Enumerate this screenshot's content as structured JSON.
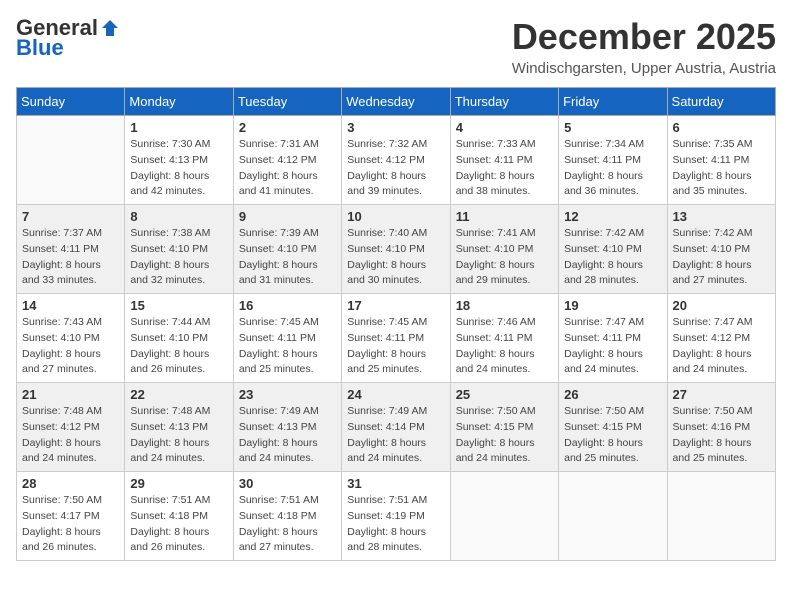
{
  "header": {
    "logo_general": "General",
    "logo_blue": "Blue",
    "month_title": "December 2025",
    "location": "Windischgarsten, Upper Austria, Austria"
  },
  "weekdays": [
    "Sunday",
    "Monday",
    "Tuesday",
    "Wednesday",
    "Thursday",
    "Friday",
    "Saturday"
  ],
  "weeks": [
    [
      {
        "day": "",
        "sunrise": "",
        "sunset": "",
        "daylight": ""
      },
      {
        "day": "1",
        "sunrise": "Sunrise: 7:30 AM",
        "sunset": "Sunset: 4:13 PM",
        "daylight": "Daylight: 8 hours and 42 minutes."
      },
      {
        "day": "2",
        "sunrise": "Sunrise: 7:31 AM",
        "sunset": "Sunset: 4:12 PM",
        "daylight": "Daylight: 8 hours and 41 minutes."
      },
      {
        "day": "3",
        "sunrise": "Sunrise: 7:32 AM",
        "sunset": "Sunset: 4:12 PM",
        "daylight": "Daylight: 8 hours and 39 minutes."
      },
      {
        "day": "4",
        "sunrise": "Sunrise: 7:33 AM",
        "sunset": "Sunset: 4:11 PM",
        "daylight": "Daylight: 8 hours and 38 minutes."
      },
      {
        "day": "5",
        "sunrise": "Sunrise: 7:34 AM",
        "sunset": "Sunset: 4:11 PM",
        "daylight": "Daylight: 8 hours and 36 minutes."
      },
      {
        "day": "6",
        "sunrise": "Sunrise: 7:35 AM",
        "sunset": "Sunset: 4:11 PM",
        "daylight": "Daylight: 8 hours and 35 minutes."
      }
    ],
    [
      {
        "day": "7",
        "sunrise": "Sunrise: 7:37 AM",
        "sunset": "Sunset: 4:11 PM",
        "daylight": "Daylight: 8 hours and 33 minutes."
      },
      {
        "day": "8",
        "sunrise": "Sunrise: 7:38 AM",
        "sunset": "Sunset: 4:10 PM",
        "daylight": "Daylight: 8 hours and 32 minutes."
      },
      {
        "day": "9",
        "sunrise": "Sunrise: 7:39 AM",
        "sunset": "Sunset: 4:10 PM",
        "daylight": "Daylight: 8 hours and 31 minutes."
      },
      {
        "day": "10",
        "sunrise": "Sunrise: 7:40 AM",
        "sunset": "Sunset: 4:10 PM",
        "daylight": "Daylight: 8 hours and 30 minutes."
      },
      {
        "day": "11",
        "sunrise": "Sunrise: 7:41 AM",
        "sunset": "Sunset: 4:10 PM",
        "daylight": "Daylight: 8 hours and 29 minutes."
      },
      {
        "day": "12",
        "sunrise": "Sunrise: 7:42 AM",
        "sunset": "Sunset: 4:10 PM",
        "daylight": "Daylight: 8 hours and 28 minutes."
      },
      {
        "day": "13",
        "sunrise": "Sunrise: 7:42 AM",
        "sunset": "Sunset: 4:10 PM",
        "daylight": "Daylight: 8 hours and 27 minutes."
      }
    ],
    [
      {
        "day": "14",
        "sunrise": "Sunrise: 7:43 AM",
        "sunset": "Sunset: 4:10 PM",
        "daylight": "Daylight: 8 hours and 27 minutes."
      },
      {
        "day": "15",
        "sunrise": "Sunrise: 7:44 AM",
        "sunset": "Sunset: 4:10 PM",
        "daylight": "Daylight: 8 hours and 26 minutes."
      },
      {
        "day": "16",
        "sunrise": "Sunrise: 7:45 AM",
        "sunset": "Sunset: 4:11 PM",
        "daylight": "Daylight: 8 hours and 25 minutes."
      },
      {
        "day": "17",
        "sunrise": "Sunrise: 7:45 AM",
        "sunset": "Sunset: 4:11 PM",
        "daylight": "Daylight: 8 hours and 25 minutes."
      },
      {
        "day": "18",
        "sunrise": "Sunrise: 7:46 AM",
        "sunset": "Sunset: 4:11 PM",
        "daylight": "Daylight: 8 hours and 24 minutes."
      },
      {
        "day": "19",
        "sunrise": "Sunrise: 7:47 AM",
        "sunset": "Sunset: 4:11 PM",
        "daylight": "Daylight: 8 hours and 24 minutes."
      },
      {
        "day": "20",
        "sunrise": "Sunrise: 7:47 AM",
        "sunset": "Sunset: 4:12 PM",
        "daylight": "Daylight: 8 hours and 24 minutes."
      }
    ],
    [
      {
        "day": "21",
        "sunrise": "Sunrise: 7:48 AM",
        "sunset": "Sunset: 4:12 PM",
        "daylight": "Daylight: 8 hours and 24 minutes."
      },
      {
        "day": "22",
        "sunrise": "Sunrise: 7:48 AM",
        "sunset": "Sunset: 4:13 PM",
        "daylight": "Daylight: 8 hours and 24 minutes."
      },
      {
        "day": "23",
        "sunrise": "Sunrise: 7:49 AM",
        "sunset": "Sunset: 4:13 PM",
        "daylight": "Daylight: 8 hours and 24 minutes."
      },
      {
        "day": "24",
        "sunrise": "Sunrise: 7:49 AM",
        "sunset": "Sunset: 4:14 PM",
        "daylight": "Daylight: 8 hours and 24 minutes."
      },
      {
        "day": "25",
        "sunrise": "Sunrise: 7:50 AM",
        "sunset": "Sunset: 4:15 PM",
        "daylight": "Daylight: 8 hours and 24 minutes."
      },
      {
        "day": "26",
        "sunrise": "Sunrise: 7:50 AM",
        "sunset": "Sunset: 4:15 PM",
        "daylight": "Daylight: 8 hours and 25 minutes."
      },
      {
        "day": "27",
        "sunrise": "Sunrise: 7:50 AM",
        "sunset": "Sunset: 4:16 PM",
        "daylight": "Daylight: 8 hours and 25 minutes."
      }
    ],
    [
      {
        "day": "28",
        "sunrise": "Sunrise: 7:50 AM",
        "sunset": "Sunset: 4:17 PM",
        "daylight": "Daylight: 8 hours and 26 minutes."
      },
      {
        "day": "29",
        "sunrise": "Sunrise: 7:51 AM",
        "sunset": "Sunset: 4:18 PM",
        "daylight": "Daylight: 8 hours and 26 minutes."
      },
      {
        "day": "30",
        "sunrise": "Sunrise: 7:51 AM",
        "sunset": "Sunset: 4:18 PM",
        "daylight": "Daylight: 8 hours and 27 minutes."
      },
      {
        "day": "31",
        "sunrise": "Sunrise: 7:51 AM",
        "sunset": "Sunset: 4:19 PM",
        "daylight": "Daylight: 8 hours and 28 minutes."
      },
      {
        "day": "",
        "sunrise": "",
        "sunset": "",
        "daylight": ""
      },
      {
        "day": "",
        "sunrise": "",
        "sunset": "",
        "daylight": ""
      },
      {
        "day": "",
        "sunrise": "",
        "sunset": "",
        "daylight": ""
      }
    ]
  ]
}
